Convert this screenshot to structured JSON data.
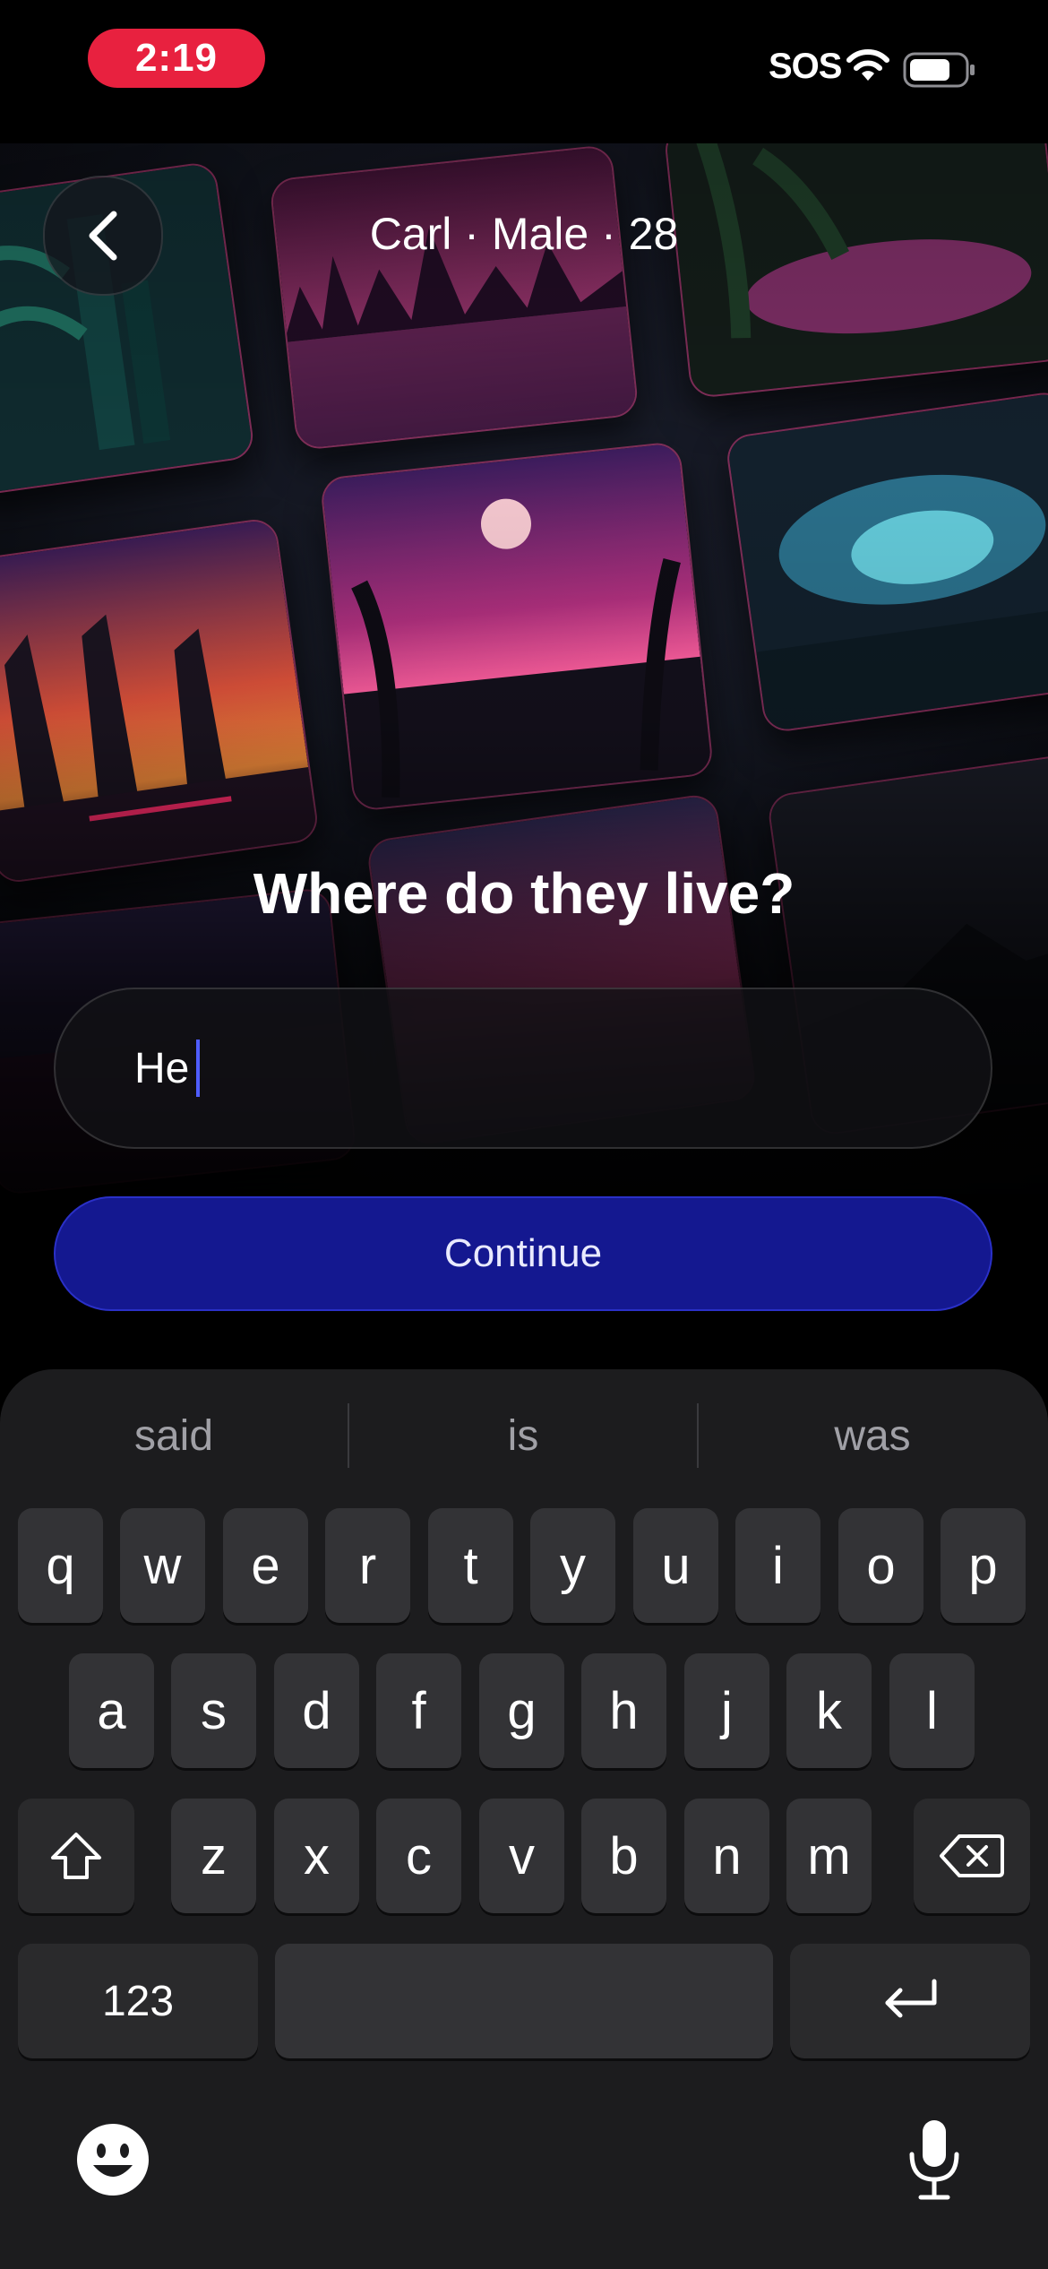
{
  "status": {
    "time": "2:19",
    "sos": "SOS"
  },
  "header": {
    "title": "Carl · Male  · 28"
  },
  "question": "Where do they live?",
  "input": {
    "value": "He"
  },
  "continue_label": "Continue",
  "keyboard": {
    "suggestions": [
      "said",
      "is",
      "was"
    ],
    "row1": [
      "q",
      "w",
      "e",
      "r",
      "t",
      "y",
      "u",
      "i",
      "o",
      "p"
    ],
    "row2": [
      "a",
      "s",
      "d",
      "f",
      "g",
      "h",
      "j",
      "k",
      "l"
    ],
    "row3": [
      "z",
      "x",
      "c",
      "v",
      "b",
      "n",
      "m"
    ],
    "numbers_label": "123"
  },
  "colors": {
    "accent": "#141890",
    "time_pill": "#e8213f",
    "caret": "#4f5dff"
  }
}
